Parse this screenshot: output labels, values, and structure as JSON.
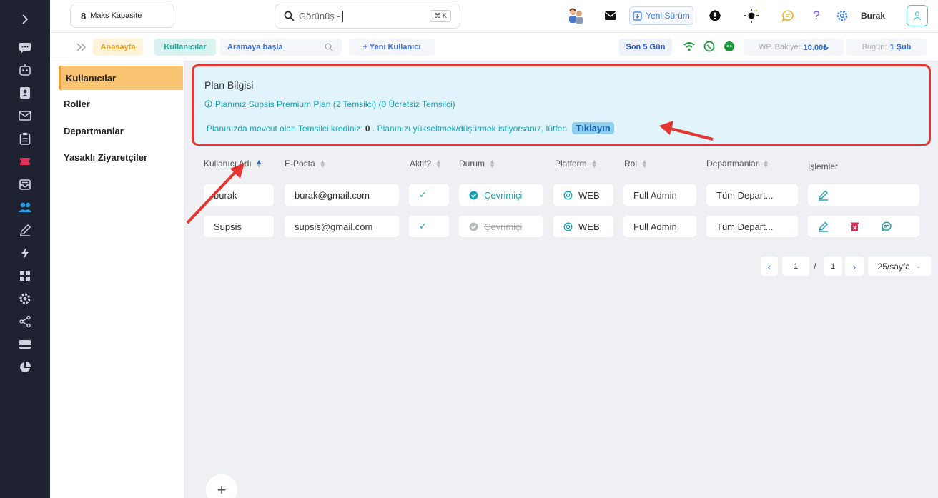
{
  "topbar": {
    "capacity_number": "8",
    "capacity_label": "Maks Kapasite",
    "search_placeholder": "Görünüş -",
    "search_shortcut": "⌘ K",
    "new_version": "Yeni Sürüm",
    "user_name": "Burak"
  },
  "breadcrumb": {
    "home": "Anasayfa",
    "users": "Kullanıcılar",
    "search": "Aramaya başla",
    "new_user": "+ Yeni Kullanıcı",
    "days": "Son 5 Gün",
    "wp_label": "WP. Bakiye:",
    "wp_value": "10.00₺",
    "today_label": "Bugün:",
    "today_value": "1 Şub"
  },
  "subnav": [
    "Kullanıcılar",
    "Roller",
    "Departmanlar",
    "Yasaklı Ziyaretçiler"
  ],
  "plan": {
    "title": "Plan Bilgisi",
    "info": "Planınız Supsis Premium Plan (2 Temsilci) (0 Ücretsiz Temsilci)",
    "credit_prefix": "Planınızda mevcut olan Temsilci krediniz:",
    "credit_value": "0",
    "credit_suffix": ". Planınızı yükseltmek/düşürmek istiyorsanız, lütfen",
    "click": "Tıklayın"
  },
  "table": {
    "headers": [
      "Kullanıcı Adı",
      "E-Posta",
      "Aktif?",
      "Durum",
      "Platform",
      "Rol",
      "Departmanlar",
      "İşlemler"
    ],
    "rows": [
      {
        "username": "burak",
        "email": "burak@gmail.com",
        "active": "✓",
        "status": "Çevrimiçi",
        "platform": "WEB",
        "role": "Full Admin",
        "department": "Tüm Depart..."
      },
      {
        "username": "Supsis",
        "email": "supsis@gmail.com",
        "active": "✓",
        "status": "Çevrimiçi",
        "platform": "WEB",
        "role": "Full Admin",
        "department": "Tüm Depart..."
      }
    ]
  },
  "pagination": {
    "prev": "‹",
    "page": "1",
    "separator": "/",
    "total": "1",
    "next": "›",
    "size": "25/sayfa"
  },
  "fab": "+",
  "colors": {
    "rail": "#1f2230",
    "accent_teal": "#14a3b6",
    "highlight_red": "#e53530",
    "active_nav": "#f8c471"
  }
}
